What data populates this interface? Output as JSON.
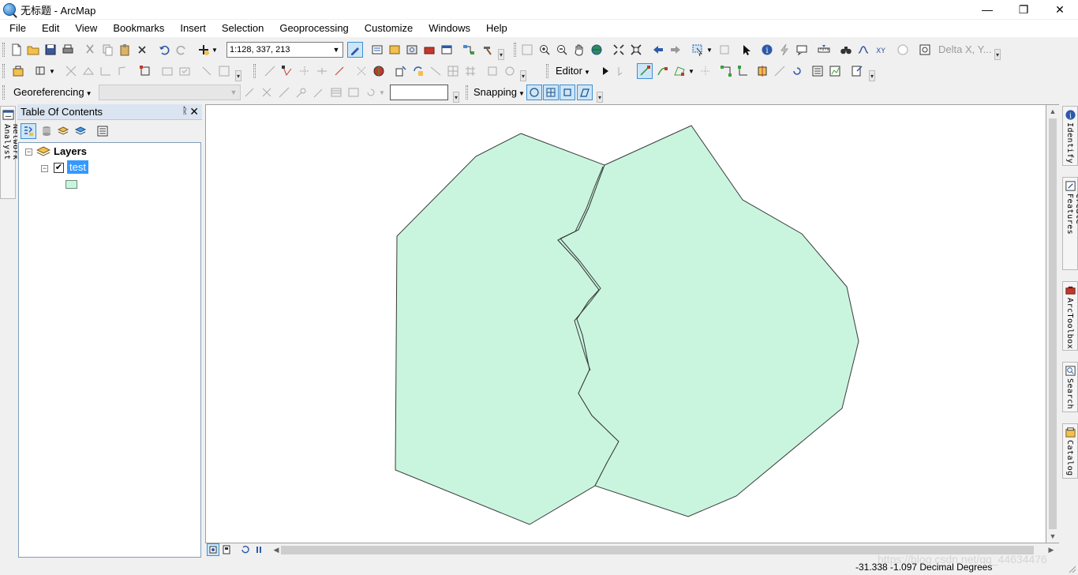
{
  "window": {
    "title": "无标题 - ArcMap",
    "minimize_glyph": "—",
    "maximize_glyph": "❐",
    "close_glyph": "✕"
  },
  "menu": [
    "File",
    "Edit",
    "View",
    "Bookmarks",
    "Insert",
    "Selection",
    "Geoprocessing",
    "Customize",
    "Windows",
    "Help"
  ],
  "toolbar": {
    "scale_value": "1:128, 337, 213",
    "delta_label": "Delta X, Y...",
    "editor_label": "Editor",
    "georeferencing_label": "Georeferencing",
    "snapping_label": "Snapping"
  },
  "left_tab": {
    "label": "Network Analyst"
  },
  "toc": {
    "title": "Table Of Contents",
    "pin_glyph": "ᚱ",
    "close_glyph": "✕",
    "layers_label": "Layers",
    "layer_name": "test",
    "layer_checked": "✔",
    "expand_glyph": "−",
    "symbol_color": "#c9f5df"
  },
  "right_tabs": [
    "Identify",
    "Create Features",
    "ArcToolbox",
    "Search",
    "Catalog"
  ],
  "map": {
    "fill_color": "#c9f5df",
    "stroke_color": "#3a3a3a"
  },
  "status": {
    "coordinates": "-31.338  -1.097 Decimal Degrees",
    "watermark": "https://blog.csdn.net/qq_44634476"
  }
}
